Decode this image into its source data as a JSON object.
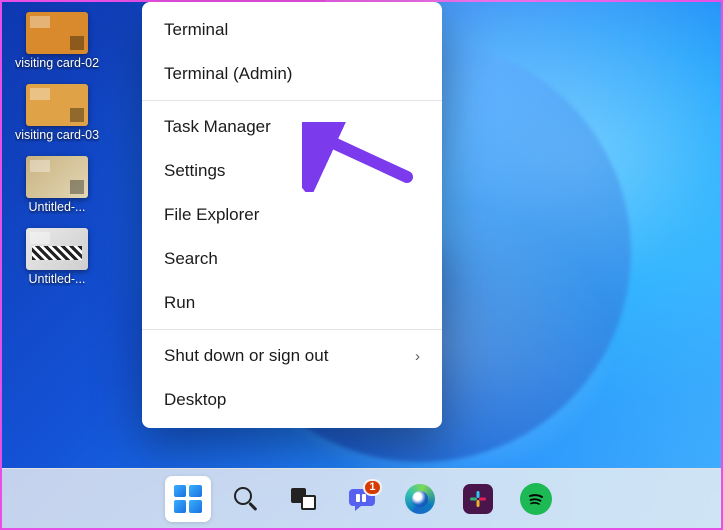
{
  "desktop_icons": [
    {
      "label": "visiting card-02",
      "thumb": "v1"
    },
    {
      "label": "visiting card-03",
      "thumb": "v2"
    },
    {
      "label": "Untitled-...",
      "thumb": "v3"
    },
    {
      "label": "Untitled-...",
      "thumb": "v4"
    }
  ],
  "winx_menu": {
    "groups": [
      [
        "Terminal",
        "Terminal (Admin)"
      ],
      [
        "Task Manager",
        "Settings",
        "File Explorer",
        "Search",
        "Run"
      ],
      [
        {
          "label": "Shut down or sign out",
          "submenu": true
        },
        "Desktop"
      ]
    ]
  },
  "annotation_arrow_points_to": "Task Manager",
  "taskbar": {
    "items": [
      {
        "id": "start",
        "name": "Start",
        "active": true
      },
      {
        "id": "search",
        "name": "Search",
        "active": false
      },
      {
        "id": "taskview",
        "name": "Task View",
        "active": false
      },
      {
        "id": "chat",
        "name": "Chat",
        "active": false,
        "badge": "1"
      },
      {
        "id": "edge",
        "name": "Microsoft Edge",
        "active": false
      },
      {
        "id": "slack",
        "name": "Slack",
        "active": false
      },
      {
        "id": "spotify",
        "name": "Spotify",
        "active": false
      }
    ]
  }
}
